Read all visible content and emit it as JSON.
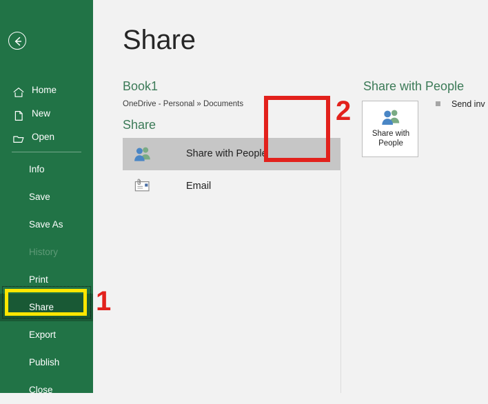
{
  "window": {
    "background_color": "#f2f2f2",
    "accent_color": "#217346"
  },
  "sidebar": {
    "background_color": "#217346",
    "back_button": {
      "name": "back-arrow",
      "label": "Back"
    },
    "top_items": [
      {
        "label": "Home",
        "icon": "home-icon"
      },
      {
        "label": "New",
        "icon": "new-document-icon"
      },
      {
        "label": "Open",
        "icon": "open-folder-icon"
      }
    ],
    "bottom_items": [
      {
        "label": "Info",
        "state": "normal"
      },
      {
        "label": "Save",
        "state": "normal"
      },
      {
        "label": "Save As",
        "state": "normal"
      },
      {
        "label": "History",
        "state": "disabled"
      },
      {
        "label": "Print",
        "state": "normal"
      },
      {
        "label": "Share",
        "state": "active"
      },
      {
        "label": "Export",
        "state": "normal"
      },
      {
        "label": "Publish",
        "state": "normal"
      },
      {
        "label": "Close",
        "state": "normal"
      }
    ]
  },
  "main": {
    "page_title": "Share",
    "document_name": "Book1",
    "document_path": "OneDrive - Personal » Documents",
    "section_title": "Share",
    "options": [
      {
        "label": "Share with People",
        "icon": "people-icon",
        "selected": true
      },
      {
        "label": "Email",
        "icon": "email-attachment-icon",
        "selected": false
      }
    ]
  },
  "right_pane": {
    "title": "Share with People",
    "button": {
      "label_line1": "Share with",
      "label_line2": "People",
      "icon": "people-icon"
    },
    "bullet": {
      "marker": "square-bullet",
      "text": "Send inv"
    }
  },
  "callouts": [
    {
      "number": "1",
      "color": "#e2211c",
      "target": "sidebar-item-share",
      "highlight_color": "#ffe600"
    },
    {
      "number": "2",
      "color": "#e2211c",
      "target": "share-with-people-button",
      "highlight_color": "#e2211c"
    }
  ]
}
